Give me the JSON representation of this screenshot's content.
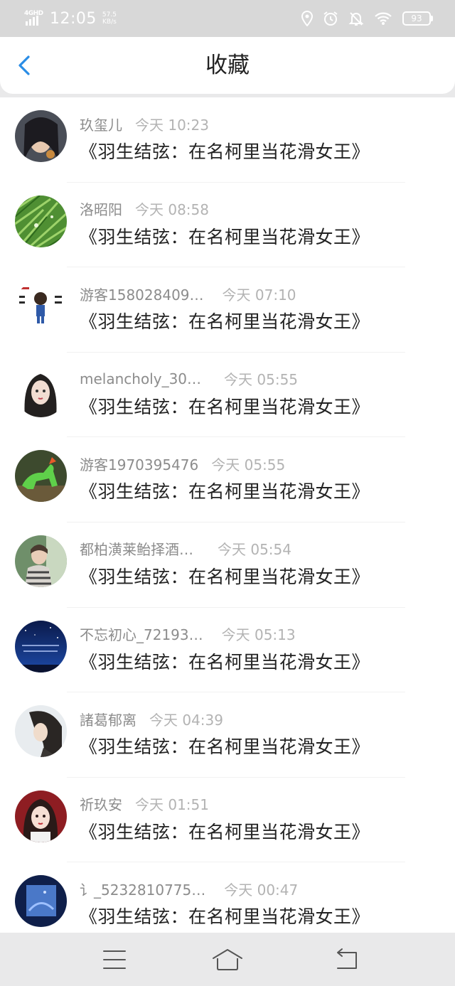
{
  "status_bar": {
    "network": "4GHD",
    "time": "12:05",
    "speed_value": "57.5",
    "speed_unit": "KB/s",
    "battery": "93"
  },
  "header": {
    "title": "收藏"
  },
  "favorites": [
    {
      "name": "玖玺儿",
      "time": "今天 10:23",
      "title": "《羽生结弦：在名柯里当花滑女王》"
    },
    {
      "name": "洛昭阳",
      "time": "今天 08:58",
      "title": "《羽生结弦：在名柯里当花滑女王》"
    },
    {
      "name": "游客158028409…",
      "time": "今天 07:10",
      "title": "《羽生结弦：在名柯里当花滑女王》"
    },
    {
      "name": "melancholy_30…",
      "time": "今天 05:55",
      "title": "《羽生结弦：在名柯里当花滑女王》"
    },
    {
      "name": "游客1970395476",
      "time": "今天 05:55",
      "title": "《羽生结弦：在名柯里当花滑女王》"
    },
    {
      "name": "都柏潢莱鲐择酒…",
      "time": "今天 05:54",
      "title": "《羽生结弦：在名柯里当花滑女王》"
    },
    {
      "name": "不忘初心_72193…",
      "time": "今天 05:13",
      "title": "《羽生结弦：在名柯里当花滑女王》"
    },
    {
      "name": "諸葛郁离",
      "time": "今天 04:39",
      "title": "《羽生结弦：在名柯里当花滑女王》"
    },
    {
      "name": "祈玖安",
      "time": "今天 01:51",
      "title": "《羽生结弦：在名柯里当花滑女王》"
    },
    {
      "name": "讠_5232810775…",
      "time": "今天 00:47",
      "title": "《羽生结弦：在名柯里当花滑女王》"
    }
  ],
  "colors": {
    "accent": "#2a8de6",
    "status_bar_bg": "#d8d8d8",
    "nav_bg": "#e9e9ea"
  },
  "icons": {
    "back": "chevron-left-icon",
    "menu": "menu-icon",
    "home": "home-icon",
    "return": "return-icon"
  }
}
